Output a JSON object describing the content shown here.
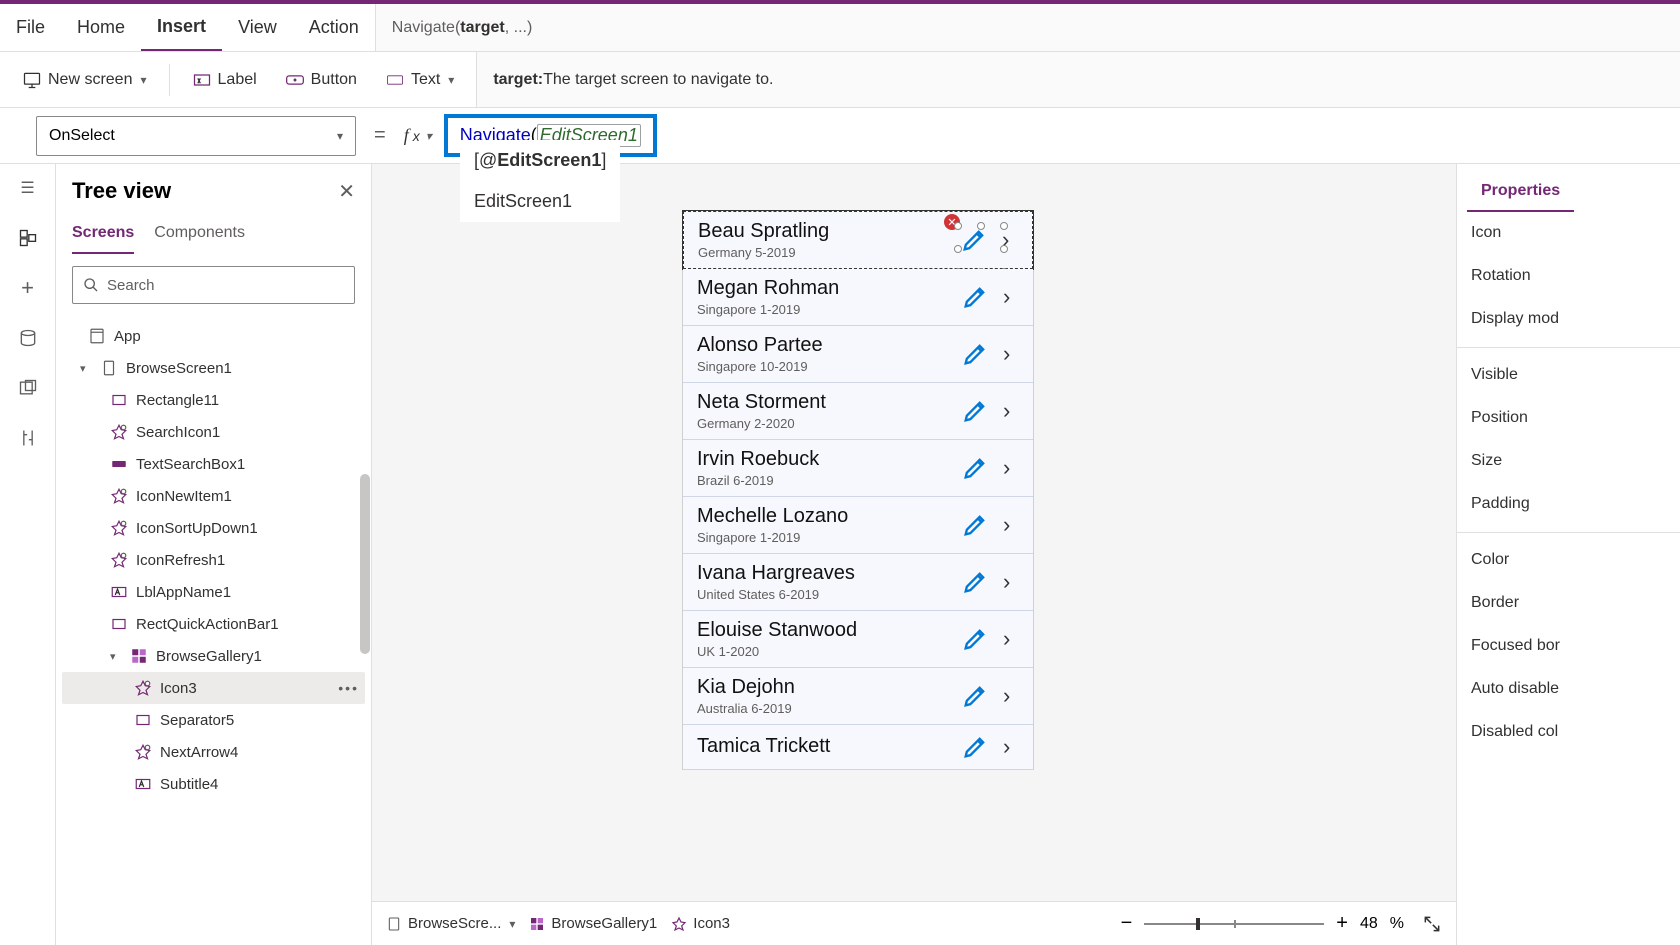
{
  "menus": {
    "file": "File",
    "home": "Home",
    "insert": "Insert",
    "view": "View",
    "action": "Action"
  },
  "signature": {
    "fn": "Navigate(",
    "bold": "target",
    "rest": ", ...)"
  },
  "toolbar": {
    "new_screen": "New screen",
    "label": "Label",
    "button": "Button",
    "text": "Text"
  },
  "param_help": {
    "name": "target:",
    "desc": " The target screen to navigate to."
  },
  "property": {
    "selected": "OnSelect"
  },
  "formula": {
    "fn": "Navigate",
    "open": "(",
    "param": "EditScreen1"
  },
  "autocomplete": {
    "item1_pre": "[@",
    "item1_bold": "EditScreen1",
    "item1_post": "]",
    "item2": "EditScreen1"
  },
  "tree": {
    "title": "Tree view",
    "tabs": {
      "screens": "Screens",
      "components": "Components"
    },
    "search_placeholder": "Search",
    "items": [
      {
        "id": "app",
        "label": "App",
        "indent": 0,
        "icon": "app",
        "caret": ""
      },
      {
        "id": "bs1",
        "label": "BrowseScreen1",
        "indent": 1,
        "icon": "screen",
        "caret": "v"
      },
      {
        "id": "rect11",
        "label": "Rectangle11",
        "indent": 2,
        "icon": "rect"
      },
      {
        "id": "sic",
        "label": "SearchIcon1",
        "indent": 2,
        "icon": "ctrl"
      },
      {
        "id": "tsb",
        "label": "TextSearchBox1",
        "indent": 2,
        "icon": "input"
      },
      {
        "id": "ini",
        "label": "IconNewItem1",
        "indent": 2,
        "icon": "ctrl"
      },
      {
        "id": "isu",
        "label": "IconSortUpDown1",
        "indent": 2,
        "icon": "ctrl"
      },
      {
        "id": "irf",
        "label": "IconRefresh1",
        "indent": 2,
        "icon": "ctrl"
      },
      {
        "id": "lan",
        "label": "LblAppName1",
        "indent": 2,
        "icon": "label"
      },
      {
        "id": "rqa",
        "label": "RectQuickActionBar1",
        "indent": 2,
        "icon": "rect"
      },
      {
        "id": "bg1",
        "label": "BrowseGallery1",
        "indent": 2,
        "icon": "gallery",
        "caret": "v"
      },
      {
        "id": "ic3",
        "label": "Icon3",
        "indent": 3,
        "icon": "ctrl",
        "selected": true,
        "dots": true
      },
      {
        "id": "sep5",
        "label": "Separator5",
        "indent": 3,
        "icon": "rect"
      },
      {
        "id": "na4",
        "label": "NextArrow4",
        "indent": 3,
        "icon": "ctrl"
      },
      {
        "id": "sub4",
        "label": "Subtitle4",
        "indent": 3,
        "icon": "label"
      }
    ]
  },
  "gallery": [
    {
      "name": "Beau Spratling",
      "sub": "Germany 5-2019",
      "first": true
    },
    {
      "name": "Megan Rohman",
      "sub": "Singapore 1-2019"
    },
    {
      "name": "Alonso Partee",
      "sub": "Singapore 10-2019"
    },
    {
      "name": "Neta Storment",
      "sub": "Germany 2-2020"
    },
    {
      "name": "Irvin Roebuck",
      "sub": "Brazil 6-2019"
    },
    {
      "name": "Mechelle Lozano",
      "sub": "Singapore 1-2019"
    },
    {
      "name": "Ivana Hargreaves",
      "sub": "United States 6-2019"
    },
    {
      "name": "Elouise Stanwood",
      "sub": "UK 1-2020"
    },
    {
      "name": "Kia Dejohn",
      "sub": "Australia 6-2019"
    },
    {
      "name": "Tamica Trickett",
      "sub": ""
    }
  ],
  "props": {
    "tab": "Properties",
    "rows": [
      "Icon",
      "Rotation",
      "Display mod",
      "Visible",
      "Position",
      "Size",
      "Padding",
      "Color",
      "Border",
      "Focused bor",
      "Auto disable",
      "Disabled col"
    ]
  },
  "breadcrumb": {
    "bs": "BrowseScre...",
    "bg": "BrowseGallery1",
    "ic": "Icon3"
  },
  "zoom": {
    "value": "48",
    "pct": "%"
  }
}
